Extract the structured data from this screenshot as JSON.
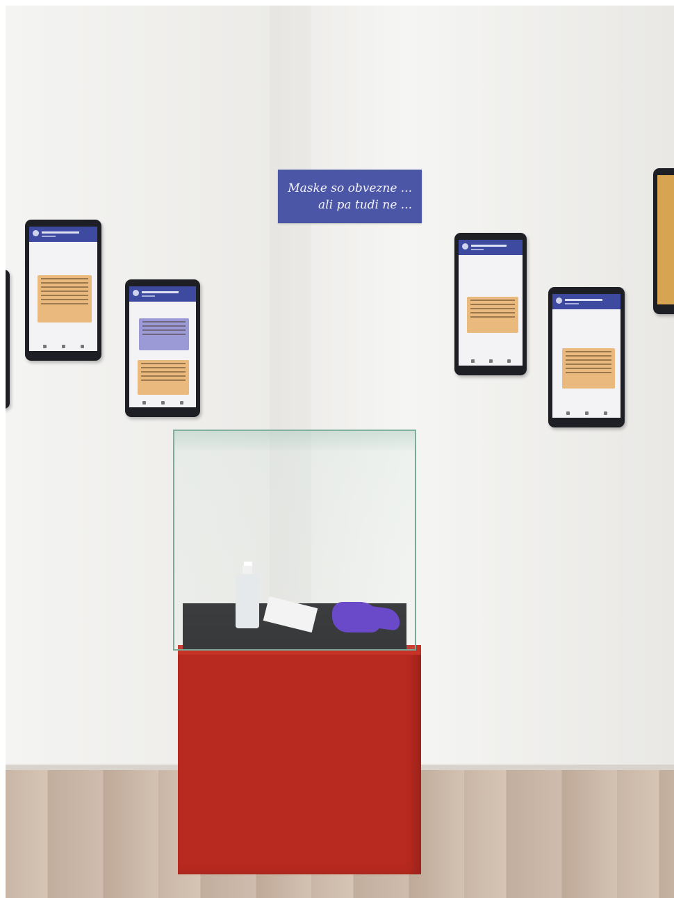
{
  "sign": {
    "line1": "Maske so obvezne ...",
    "line2": "ali pa tudi ne ..."
  },
  "scene": {
    "wall_color": "#efeeeb",
    "sign_color": "#4b56a6",
    "pedestal_color": "#b8291f",
    "floor_color": "#cbb8a8"
  },
  "objects": [
    "hand-sanitizer-bottle",
    "face-mask",
    "purple-gloves",
    "glass-display-case",
    "red-pedestal"
  ]
}
